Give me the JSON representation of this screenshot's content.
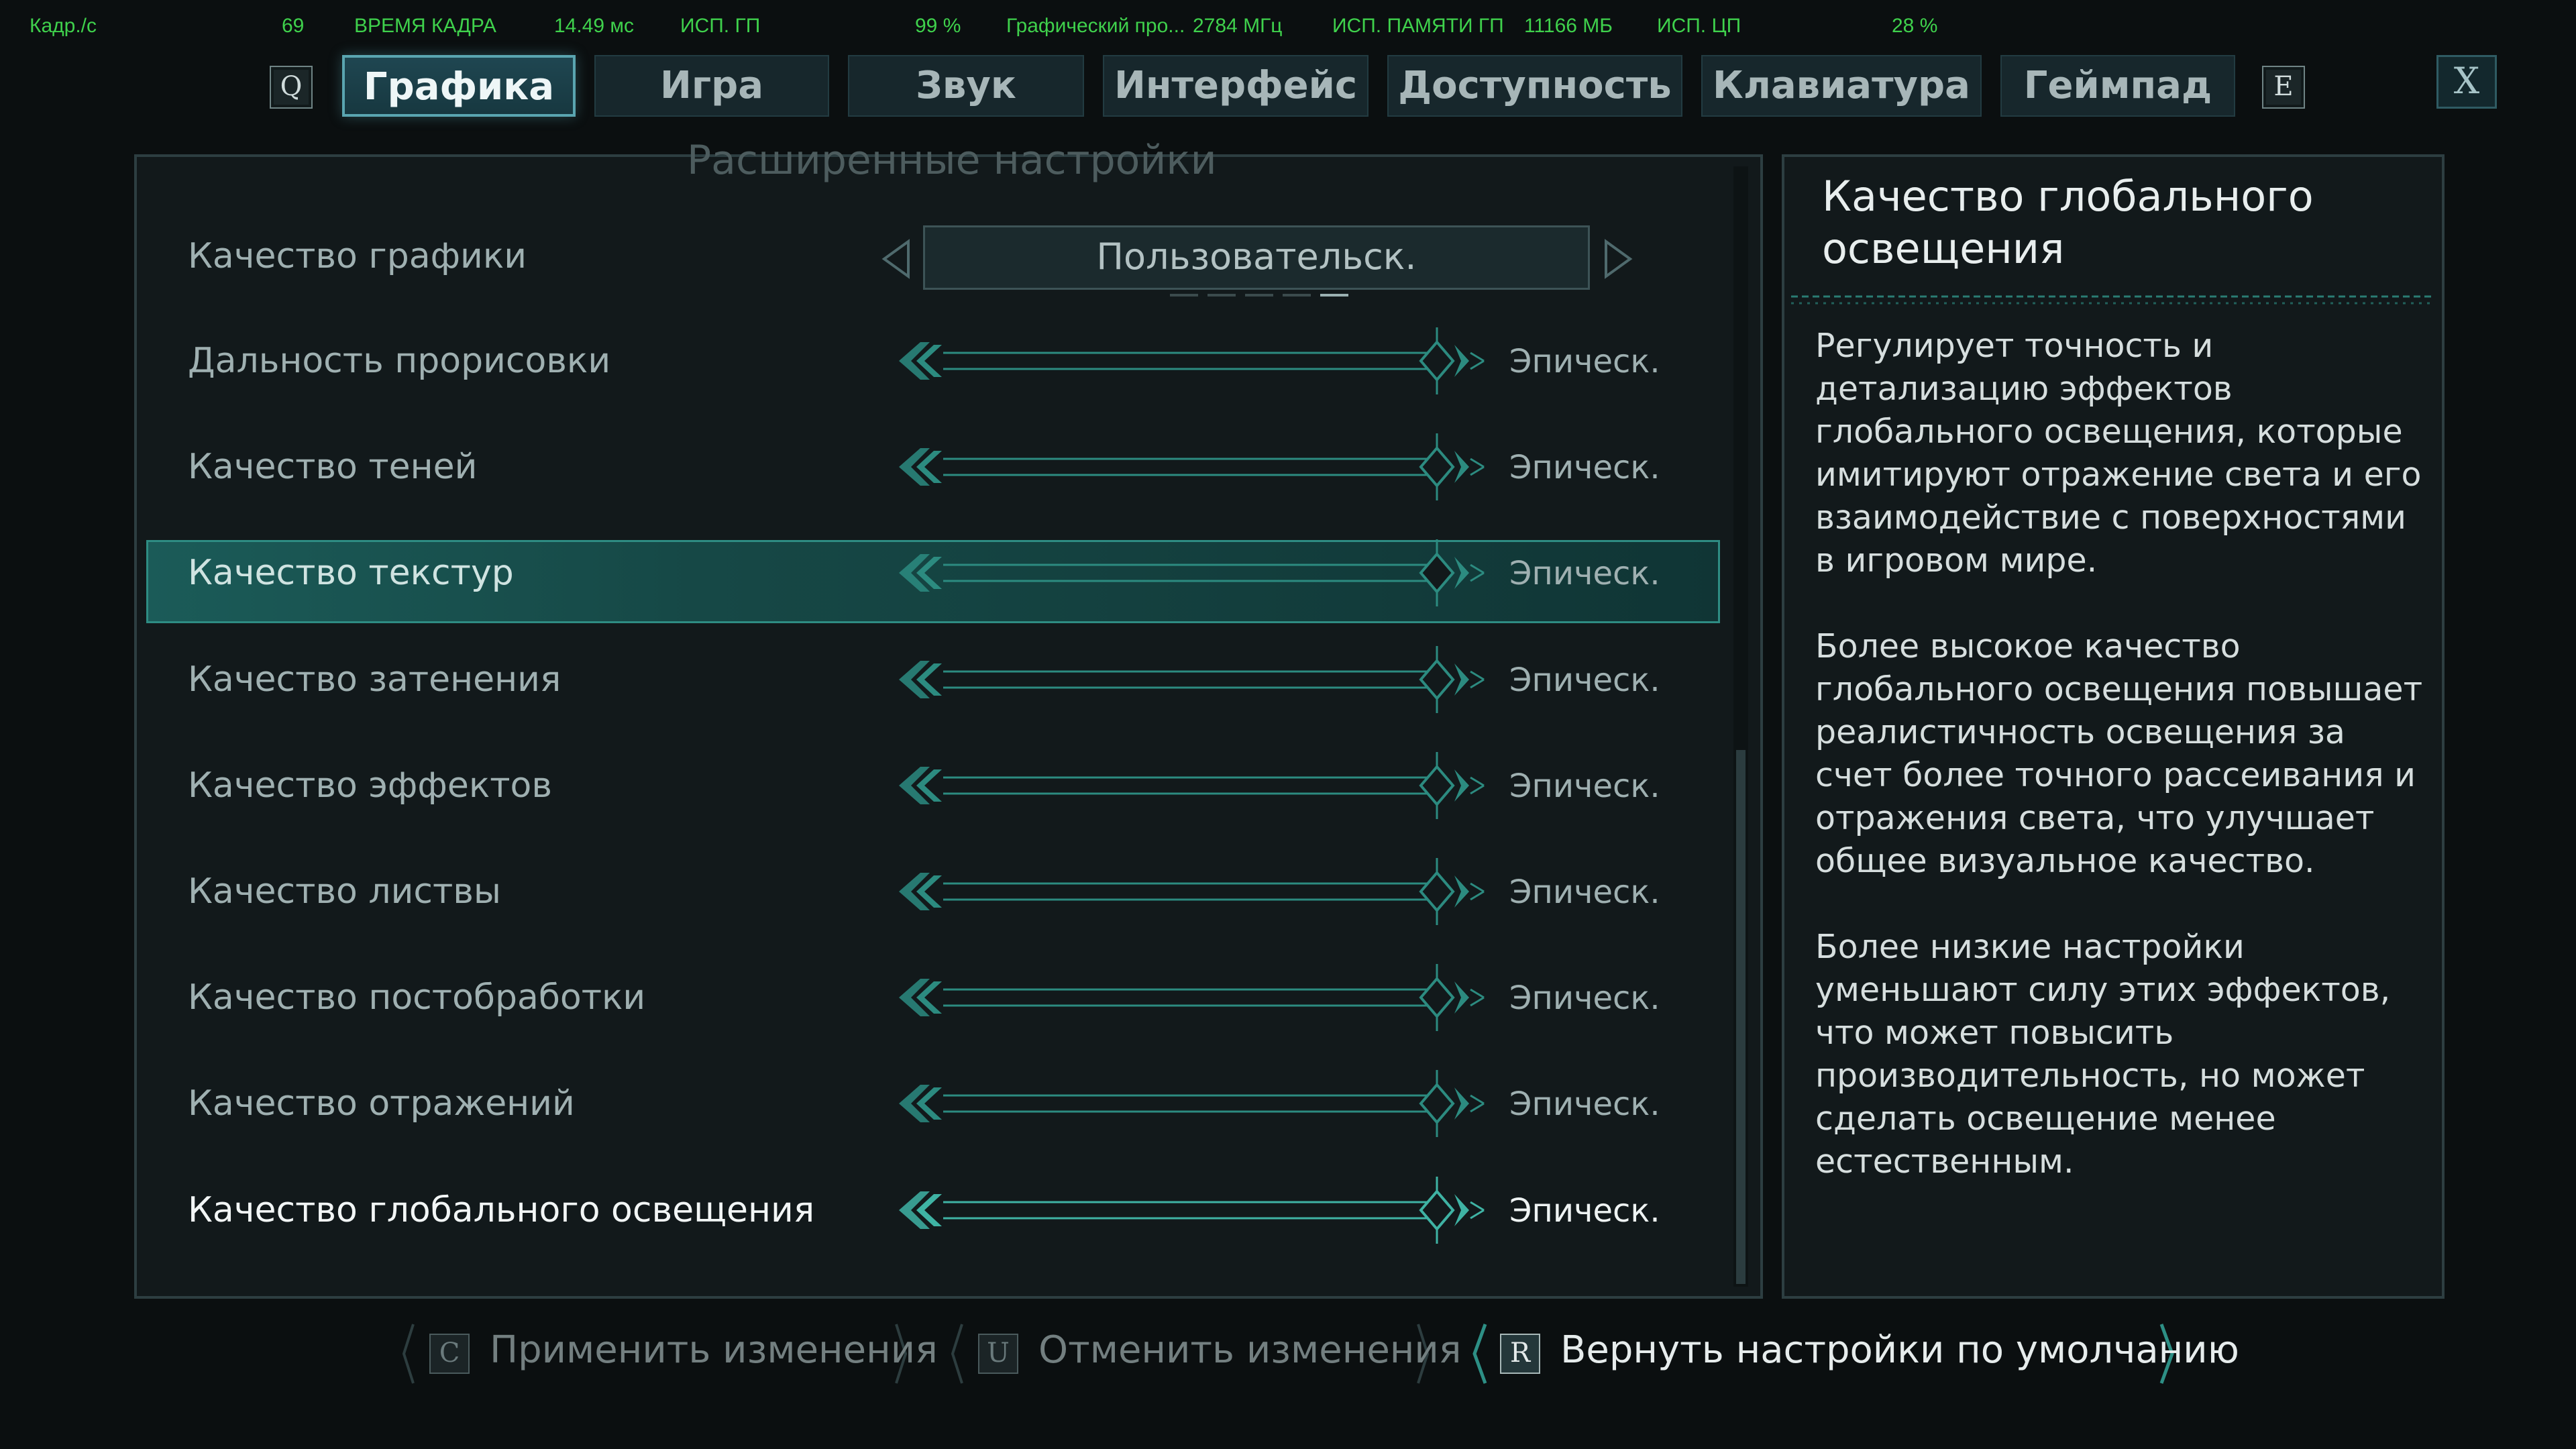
{
  "perf": {
    "fps_label": "Кадр./с",
    "fps_value": "69",
    "frametime_label": "ВРЕМЯ КАДРА",
    "frametime_value": "14.49 мс",
    "gpu_label": "ИСП. ГП",
    "gpu_value": "99 %",
    "gpu_clock_label": "Графический про...",
    "gpu_clock_value": "2784 МГц",
    "vram_label": "ИСП. ПАМЯТИ ГП",
    "vram_value": "11166 МБ",
    "cpu_label": "ИСП. ЦП",
    "cpu_value": "28 %"
  },
  "nav": {
    "prev_key": "Q",
    "next_key": "E",
    "close_label": "X",
    "tabs": [
      {
        "label": "Графика",
        "active": true
      },
      {
        "label": "Игра"
      },
      {
        "label": "Звук"
      },
      {
        "label": "Интерфейс"
      },
      {
        "label": "Доступность"
      },
      {
        "label": "Клавиатура"
      },
      {
        "label": "Геймпад"
      }
    ]
  },
  "settings": {
    "section_title": "Расширенные настройки",
    "preset": {
      "label": "Качество графики",
      "value": "Пользовательск.",
      "dots_total": 5,
      "dots_active_index": 4
    },
    "rows": [
      {
        "label": "Дальность прорисовки",
        "value": "Эпическ.",
        "level": 1.0
      },
      {
        "label": "Качество теней",
        "value": "Эпическ.",
        "level": 1.0
      },
      {
        "label": "Качество текстур",
        "value": "Эпическ.",
        "level": 1.0,
        "hover": true
      },
      {
        "label": "Качество затенения",
        "value": "Эпическ.",
        "level": 1.0
      },
      {
        "label": "Качество эффектов",
        "value": "Эпическ.",
        "level": 1.0
      },
      {
        "label": "Качество листвы",
        "value": "Эпическ.",
        "level": 1.0
      },
      {
        "label": "Качество постобработки",
        "value": "Эпическ.",
        "level": 1.0
      },
      {
        "label": "Качество отражений",
        "value": "Эпическ.",
        "level": 1.0
      },
      {
        "label": "Качество глобального освещения",
        "value": "Эпическ.",
        "level": 1.0,
        "selected": true
      }
    ]
  },
  "description": {
    "title": "Качество глобального освещения",
    "paragraphs": [
      "Регулирует точность и детализацию эффектов глобального освещения, которые имитируют отражение света и его взаимодействие с поверхностями в игровом мире.",
      "Более высокое качество глобального освещения повышает реалистичность освещения за счет более точного рассеивания и отражения света, что улучшает общее визуальное качество.",
      "Более низкие настройки уменьшают силу этих эффектов, что может повысить производительность, но может сделать освещение менее естественным."
    ]
  },
  "footer": {
    "apply": {
      "key": "C",
      "label": "Применить изменения"
    },
    "cancel": {
      "key": "U",
      "label": "Отменить изменения"
    },
    "reset": {
      "key": "R",
      "label": "Вернуть настройки по умолчанию"
    }
  },
  "colors": {
    "accent": "#2e8c83",
    "slider_line": "#2c8b80",
    "slider_line_active": "#3fb3a4"
  }
}
